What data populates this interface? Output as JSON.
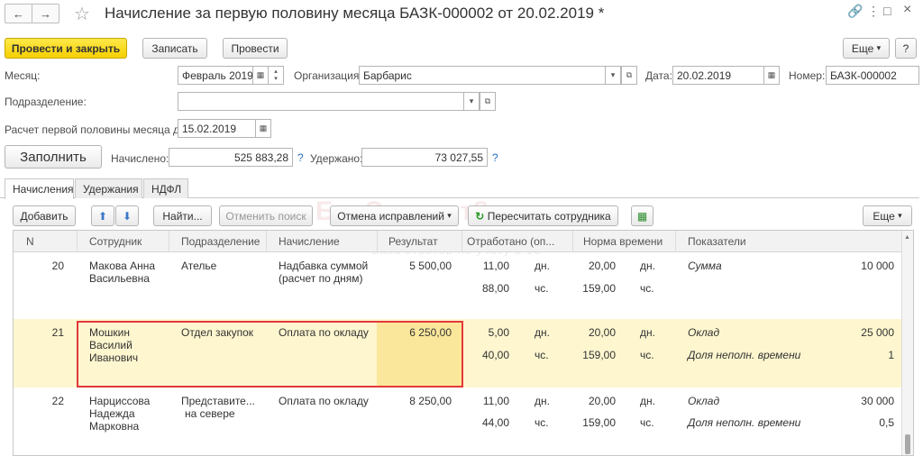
{
  "window": {
    "title": "Начисление за первую половину месяца БАЗК-000002 от 20.02.2019 *",
    "nav_back": "←",
    "nav_fwd": "→",
    "star": "☆",
    "ctl_link": "🔗",
    "ctl_more": "⋮",
    "ctl_max": "□",
    "ctl_close": "×"
  },
  "toolbar": {
    "post_close": "Провести и закрыть",
    "save": "Записать",
    "post": "Провести",
    "more": "Еще",
    "more_arrow": "▾",
    "help": "?"
  },
  "form": {
    "month_label": "Месяц:",
    "month_value": "Февраль 2019",
    "org_label": "Организация:",
    "org_value": "Барбарис",
    "date_label": "Дата:",
    "date_value": "20.02.2019",
    "number_label": "Номер:",
    "number_value": "БАЗК-000002",
    "dept_label": "Подразделение:",
    "dept_value": "",
    "calc_label": "Расчет первой половины месяца до:",
    "calc_value": "15.02.2019",
    "fill_button": "Заполнить",
    "accrued_label": "Начислено:",
    "accrued_value": "525 883,28",
    "withheld_label": "Удержано:",
    "withheld_value": "73 027,55",
    "q": "?",
    "cal": "▦",
    "dd": "▾",
    "open": "⧉",
    "up": "▴",
    "down": "▾"
  },
  "tabs": [
    "Начисления",
    "Удержания",
    "НДФЛ"
  ],
  "table_toolbar": {
    "add": "Добавить",
    "up": "⬆",
    "down": "⬇",
    "find": "Найти...",
    "cancel_search": "Отменить поиск",
    "cancel_corrections": "Отмена исправлений",
    "recalc": "Пересчитать сотрудника",
    "recalc_icon": "↻",
    "grid_icon": "▦",
    "more": "Еще",
    "more_arrow": "▾"
  },
  "watermark": {
    "brand": "БухЭксперт8",
    "tagline": "База ответов по учёту в 1С"
  },
  "table": {
    "headers": [
      "N",
      "Сотрудник",
      "Подразделение",
      "Начисление",
      "Результат",
      "Отработано (оп...",
      "Норма времени",
      "Показатели"
    ],
    "rows": [
      {
        "n": "20",
        "employee": [
          "Макова Анна",
          "Васильевна"
        ],
        "dept": [
          "Ателье"
        ],
        "accrual": [
          "Надбавка суммой",
          "(расчет по дням)"
        ],
        "result": "5 500,00",
        "worked": [
          [
            "11,00",
            "дн."
          ],
          [
            "88,00",
            "чс."
          ]
        ],
        "norm": [
          [
            "20,00",
            "дн."
          ],
          [
            "159,00",
            "чс."
          ]
        ],
        "indicators": [
          [
            "Сумма",
            "10 000"
          ]
        ]
      },
      {
        "n": "21",
        "employee": [
          "Мошкин",
          "Василий",
          "Иванович"
        ],
        "dept": [
          "Отдел закупок"
        ],
        "accrual": [
          "Оплата по окладу"
        ],
        "result": "6 250,00",
        "worked": [
          [
            "5,00",
            "дн."
          ],
          [
            "40,00",
            "чс."
          ]
        ],
        "norm": [
          [
            "20,00",
            "дн."
          ],
          [
            "159,00",
            "чс."
          ]
        ],
        "indicators": [
          [
            "Оклад",
            "25 000"
          ],
          [
            "Доля неполн. времени",
            "1"
          ]
        ]
      },
      {
        "n": "22",
        "employee": [
          "Нарциссова",
          "Надежда",
          "Марковна"
        ],
        "dept": [
          "Представите...",
          "на севере"
        ],
        "accrual": [
          "Оплата по окладу"
        ],
        "result": "8 250,00",
        "worked": [
          [
            "11,00",
            "дн."
          ],
          [
            "44,00",
            "чс."
          ]
        ],
        "norm": [
          [
            "20,00",
            "дн."
          ],
          [
            "159,00",
            "чс."
          ]
        ],
        "indicators": [
          [
            "Оклад",
            "30 000"
          ],
          [
            "Доля неполн. времени",
            "0,5"
          ]
        ]
      }
    ]
  }
}
